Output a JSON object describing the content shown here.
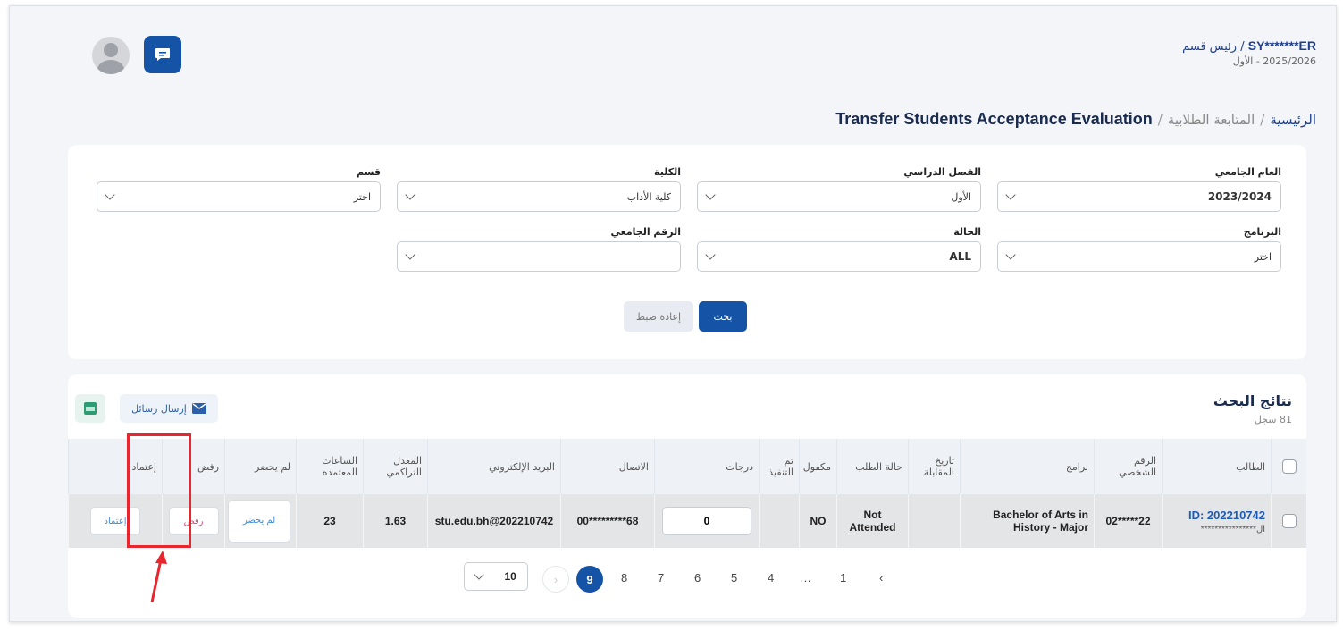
{
  "header": {
    "user_name": "SY*******ER",
    "user_role": "/ رئيس قسم",
    "term": "2025/2026 - الأول"
  },
  "breadcrumb": {
    "home": "الرئيسية",
    "sep1": "/",
    "section": "المتابعة الطلابية",
    "sep2": "/",
    "current": "Transfer Students Acceptance Evaluation"
  },
  "filters": {
    "academic_year": {
      "label": "العام الجامعي",
      "value": "2023/2024"
    },
    "semester": {
      "label": "الفصل الدراسي",
      "value": "الأول"
    },
    "college": {
      "label": "الكلية",
      "value": "كلية الأداب"
    },
    "department": {
      "label": "قسم",
      "value": "اختر"
    },
    "program": {
      "label": "البرنامج",
      "value": "اختر"
    },
    "status": {
      "label": "الحالة",
      "value": "ALL"
    },
    "university_id": {
      "label": "الرقم الجامعي",
      "value": ""
    },
    "search_label": "بحث",
    "reset_label": "إعادة ضبط"
  },
  "results": {
    "title": "نتائج البحث",
    "count": "81 سجل",
    "send_messages_label": "إرسال رسائل",
    "columns": {
      "student": "الطالب",
      "personal_id": "الرقم الشخصي",
      "programs": "برامج",
      "interview_date": "تاريخ المقابلة",
      "request_status": "حالة الطلب",
      "sponsored": "مكفول",
      "executed": "تم التنفيذ",
      "grades": "درجات",
      "contact": "الاتصال",
      "email": "البريد الإلكتروني",
      "gpa": "المعدل التراكمي",
      "credit_hours": "الساعات المعتمده",
      "absent": "لم يحضر",
      "reject": "رفض",
      "approve": "إعتماد"
    },
    "rows": [
      {
        "student_id": "ID: 202210742",
        "student_name": "ال****************",
        "personal_id": "22*****02",
        "program": "Bachelor of Arts in History - Major",
        "interview_date": "",
        "request_status": "Not Attended",
        "sponsored": "NO",
        "executed": "",
        "grade": "0",
        "contact": "68*********00",
        "email": "stu.edu.bh@202210742",
        "gpa": "1.63",
        "credit_hours": "23",
        "absent_btn": "لم يحضر",
        "reject_btn": "رفض",
        "approve_btn": "إعتماد"
      }
    ],
    "pagination": {
      "prev": "‹",
      "pages": [
        "1",
        "…",
        "4",
        "5",
        "6",
        "7",
        "8",
        "9"
      ],
      "active": "9",
      "next": "›",
      "page_size": "10"
    }
  }
}
